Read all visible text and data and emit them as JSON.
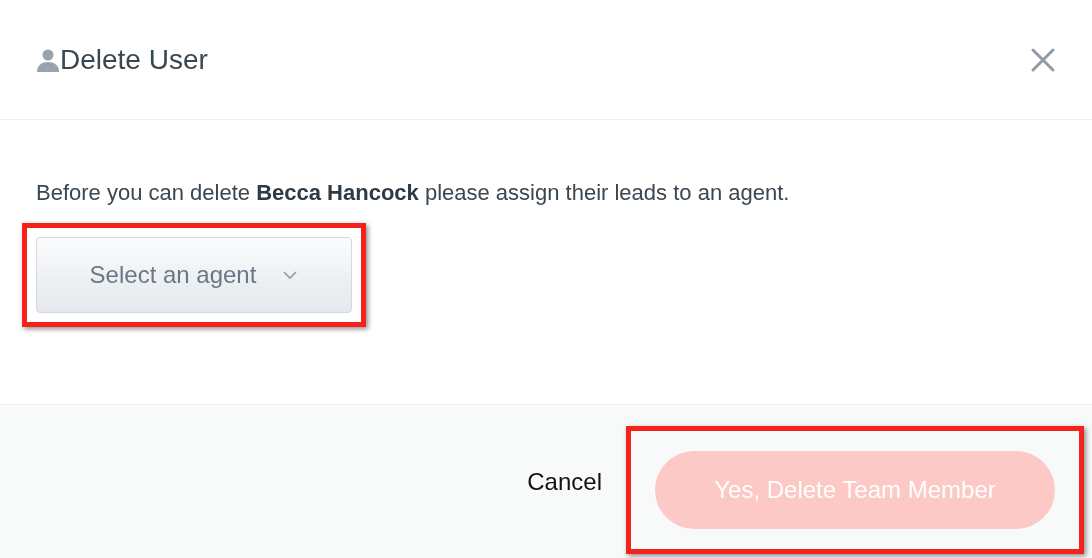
{
  "dialog": {
    "title": "Delete User",
    "message": "Before you can delete **Becca Hancock** please assign their leads to an agent.",
    "agent_select": {
      "placeholder": "Select an agent",
      "highlighted": true
    },
    "buttons": [
      {
        "kind": "link",
        "label": "Cancel"
      },
      {
        "kind": "primary",
        "label": "Yes, Delete Team Member",
        "disabled": true,
        "highlighted": true
      }
    ]
  }
}
